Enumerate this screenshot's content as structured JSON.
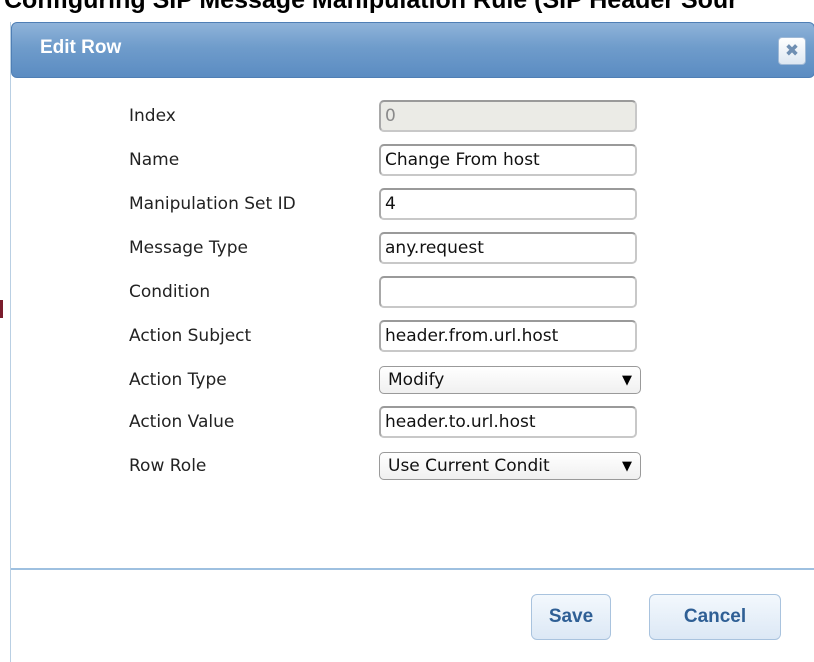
{
  "background": {
    "heading": "Configuring SIP Message Manipulation Rule (SIP Header Sour"
  },
  "dialog": {
    "title": "Edit Row",
    "close_icon": "close-icon"
  },
  "form": {
    "index": {
      "label": "Index",
      "value": "0"
    },
    "name": {
      "label": "Name",
      "value": "Change From host"
    },
    "manipulation_set_id": {
      "label": "Manipulation Set ID",
      "value": "4"
    },
    "message_type": {
      "label": "Message Type",
      "value": "any.request"
    },
    "condition": {
      "label": "Condition",
      "value": ""
    },
    "action_subject": {
      "label": "Action Subject",
      "value": "header.from.url.host"
    },
    "action_type": {
      "label": "Action Type",
      "value": "Modify"
    },
    "action_value": {
      "label": "Action Value",
      "value": "header.to.url.host"
    },
    "row_role": {
      "label": "Row Role",
      "value": "Use Current Condit"
    }
  },
  "buttons": {
    "save": "Save",
    "cancel": "Cancel"
  },
  "colors": {
    "titlebar": "#6f9ccb",
    "button_text": "#2f5f95",
    "divider": "#9ec0e0"
  }
}
